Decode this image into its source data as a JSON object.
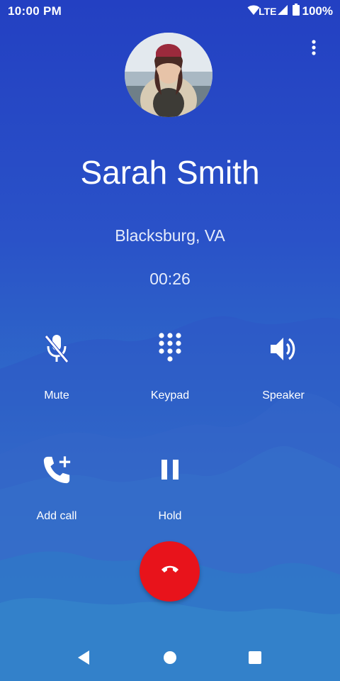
{
  "status_bar": {
    "time": "10:00 PM",
    "network": "LTE",
    "battery": "100%",
    "icons": [
      "wifi-icon",
      "signal-icon",
      "battery-icon"
    ]
  },
  "menu": {
    "icon": "more-vert-icon"
  },
  "caller": {
    "name": "Sarah Smith",
    "location": "Blacksburg, VA",
    "duration": "00:26"
  },
  "actions": [
    {
      "label": "Mute",
      "icon": "mic-off-icon"
    },
    {
      "label": "Keypad",
      "icon": "dialpad-icon"
    },
    {
      "label": "Speaker",
      "icon": "volume-up-icon"
    },
    {
      "label": "Add call",
      "icon": "add-call-icon"
    },
    {
      "label": "Hold",
      "icon": "pause-icon"
    }
  ],
  "end_call": {
    "icon": "call-end-icon",
    "color": "#e8131b"
  },
  "navigation": {
    "icons": [
      "back-icon",
      "home-icon",
      "recents-icon"
    ]
  },
  "colors": {
    "background_top": "#2340c2",
    "background_bottom": "#3f90cf",
    "text": "#ffffff"
  }
}
